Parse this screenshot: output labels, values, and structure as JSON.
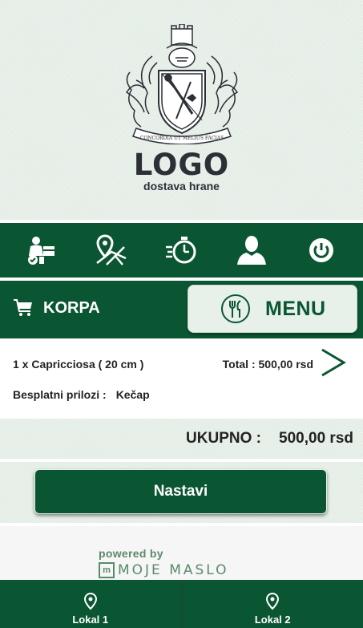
{
  "header": {
    "crest_motto": "CONCORDIA UT MELIUS FACIAS",
    "logo_title": "LOGO",
    "logo_subtitle": "dostava hrane"
  },
  "icon_nav": [
    {
      "name": "delivery-icon"
    },
    {
      "name": "location-map-icon"
    },
    {
      "name": "stopwatch-icon"
    },
    {
      "name": "user-icon"
    },
    {
      "name": "power-icon"
    }
  ],
  "cart_bar": {
    "korpa_label": "KORPA",
    "menu_label": "MENU"
  },
  "order": {
    "item_name": "1 x Capricciosa ( 20 cm )",
    "item_total": "Total : 500,00 rsd",
    "extras_label": "Besplatni prilozi :",
    "extras_value": "Kečap"
  },
  "summary": {
    "total_label": "UKUPNO :",
    "total_value": "500,00 rsd"
  },
  "cta": {
    "continue_label": "Nastavi"
  },
  "footer_brand": {
    "powered_by": "powered by",
    "brand_mark": "m",
    "brand_name": "MOJE MASLO"
  },
  "bottom_nav": {
    "location_1": "Lokal 1",
    "location_2": "Lokal 2"
  },
  "colors": {
    "brand_green": "#0b5632",
    "background": "#e6efe8",
    "accent_green": "#5a8a6a"
  }
}
